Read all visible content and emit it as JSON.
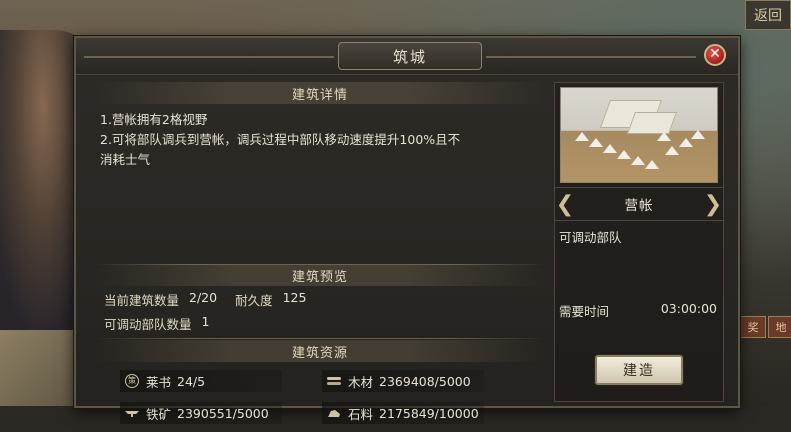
{
  "background": {
    "return_button": "返回",
    "side_tag_1": "奖",
    "side_tag_2": "地"
  },
  "dialog": {
    "title": "筑城",
    "close_symbol": "✕"
  },
  "details": {
    "section_title": "建筑详情",
    "line1": "1.营帐拥有2格视野",
    "line2": "2.可将部队调兵到营帐，调兵过程中部队移动速度提升100%且不",
    "line3": "消耗士气"
  },
  "preview": {
    "section_title": "建筑预览",
    "count_label": "当前建筑数量",
    "count_value": "2/20",
    "durability_label": "耐久度",
    "durability_value": "125",
    "troops_label": "可调动部队数量",
    "troops_value": "1"
  },
  "resources": {
    "section_title": "建筑资源",
    "items": [
      {
        "icon": "seal-icon",
        "label": "莱书",
        "value": "24/5"
      },
      {
        "icon": "wood-icon",
        "label": "木材",
        "value": "2369408/5000"
      },
      {
        "icon": "iron-icon",
        "label": "铁矿",
        "value": "2390551/5000"
      },
      {
        "icon": "stone-icon",
        "label": "石料",
        "value": "2175849/10000"
      }
    ]
  },
  "building": {
    "name": "营帐",
    "effect": "可调动部队",
    "time_label": "需要时间",
    "time_value": "03:00:00",
    "build_button": "建造",
    "prev_symbol": "❮",
    "next_symbol": "❯"
  },
  "colors": {
    "panel_bg": "#2e2b27",
    "border": "#5f5545",
    "text": "#e8e2d4",
    "close_red": "#c0312a"
  }
}
